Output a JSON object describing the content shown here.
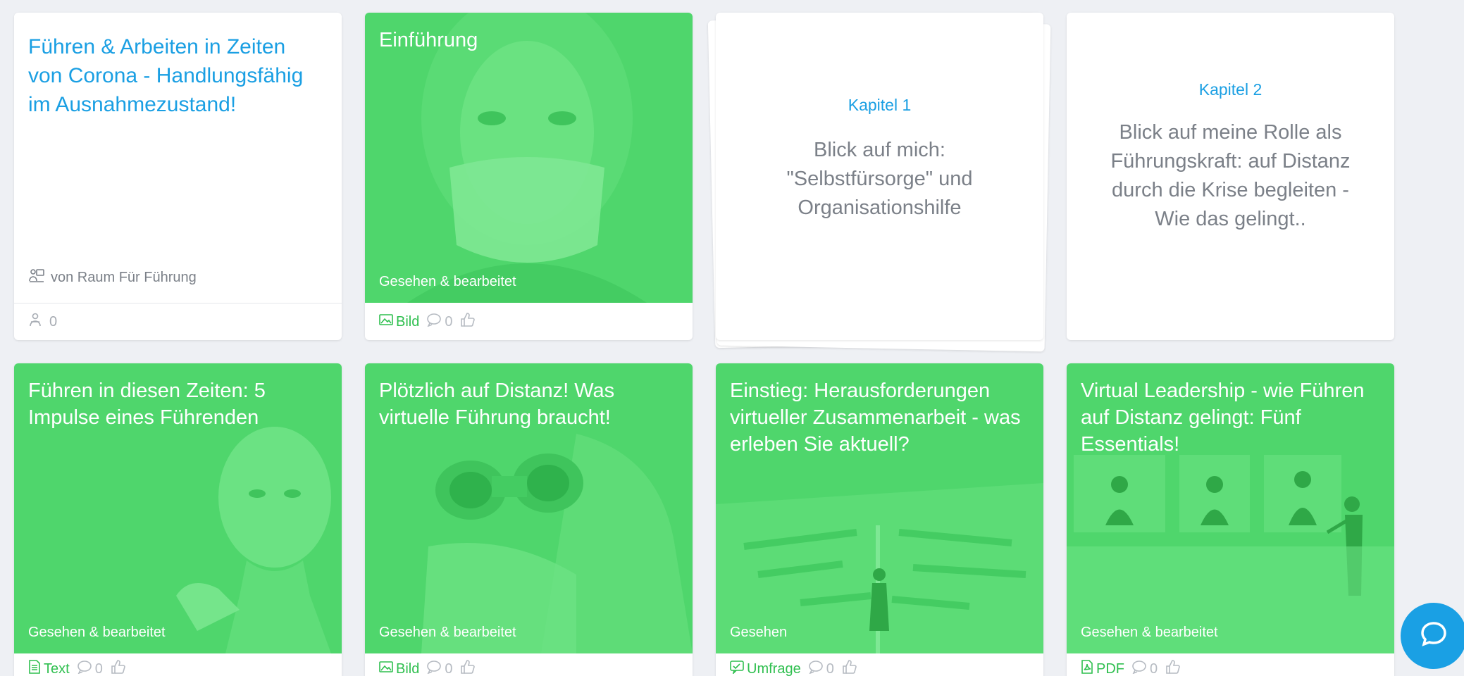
{
  "course": {
    "title": "Führen & Arbeiten in Zeiten von Corona - Handlungsfähig im Ausnahmezustand!",
    "author": "von Raum Für  Führung",
    "participants": "0"
  },
  "cards": [
    {
      "title": "Einführung",
      "status": "Gesehen & bearbeitet",
      "type": "Bild",
      "comments": "0"
    },
    {
      "title": "Führen in diesen Zeiten: 5 Impulse eines Führenden",
      "status": "Gesehen & bearbeitet",
      "type": "Text",
      "comments": "0"
    },
    {
      "title": "Plötzlich auf Distanz! Was virtuelle Führung braucht!",
      "status": "Gesehen & bearbeitet",
      "type": "Bild",
      "comments": "0"
    },
    {
      "title": "Einstieg: Herausforderungen virtueller Zusammenarbeit - was erleben Sie aktuell?",
      "status": "Gesehen",
      "type": "Umfrage",
      "comments": "0"
    },
    {
      "title": "Virtual Leadership - wie Führen auf Distanz gelingt: Fünf Essentials!",
      "status": "Gesehen & bearbeitet",
      "type": "PDF",
      "comments": "0"
    }
  ],
  "chapters": [
    {
      "label": "Kapitel 1",
      "text": "Blick auf mich: \"Selbstfürsorge\" und Organisationshilfe"
    },
    {
      "label": "Kapitel 2",
      "text": "Blick auf meine Rolle als Führungskraft: auf Distanz durch die Krise begleiten - Wie das gelingt.."
    }
  ],
  "icons": {
    "author": "presenter-icon",
    "participants": "participants-icon",
    "comment": "comment-bubble-icon",
    "like": "thumbs-up-icon",
    "image": "image-icon",
    "text": "document-icon",
    "survey": "survey-icon",
    "pdf": "pdf-icon",
    "chat": "chat-icon"
  },
  "colors": {
    "accent_blue": "#1a9fe3",
    "media_green": "#4fd66c",
    "type_green": "#2fbf4f",
    "muted_text": "#7b8088"
  }
}
